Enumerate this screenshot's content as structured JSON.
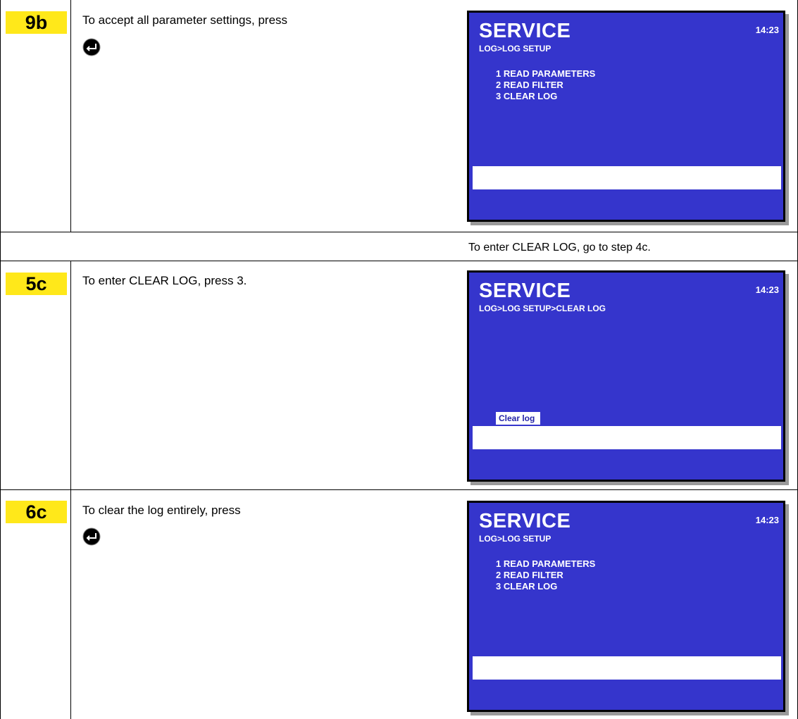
{
  "rows": [
    {
      "step": "9b",
      "instruction": "To accept all parameter settings, press",
      "icon": "enter-key-icon",
      "screen": {
        "title": "SERVICE",
        "time": "14:23",
        "breadcrumb": "LOG>LOG SETUP",
        "menu": [
          "1 READ PARAMETERS",
          "2 READ FILTER",
          "3 CLEAR LOG"
        ]
      }
    },
    {
      "note": "To enter CLEAR LOG, go to step 4c."
    },
    {
      "step": "5c",
      "instruction": "To enter CLEAR LOG, press 3.",
      "screen": {
        "title": "SERVICE",
        "time": "14:23",
        "breadcrumb": "LOG>LOG SETUP>CLEAR LOG",
        "selected_option": "Clear log"
      }
    },
    {
      "step": "6c",
      "instruction": "To clear the log entirely, press",
      "icon": "enter-key-icon",
      "screen": {
        "title": "SERVICE",
        "time": "14:23",
        "breadcrumb": "LOG>LOG SETUP",
        "menu": [
          "1 READ PARAMETERS",
          "2 READ FILTER",
          "3 CLEAR LOG"
        ]
      }
    }
  ]
}
